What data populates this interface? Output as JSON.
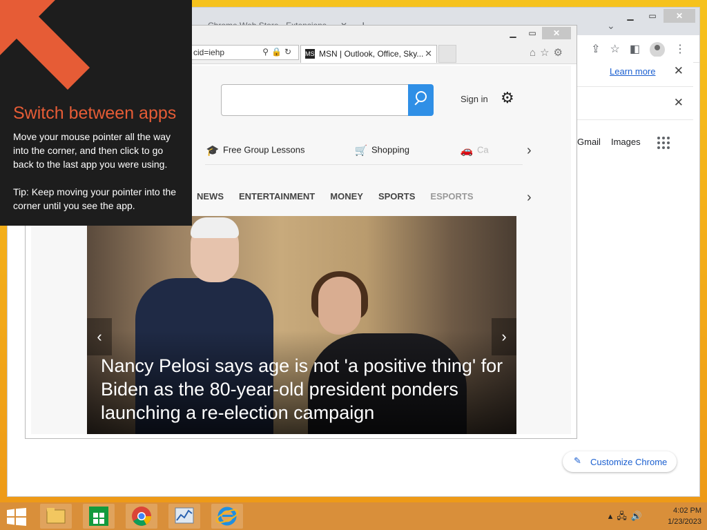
{
  "chrome": {
    "tab_label": "Chrome Web Store - Extensions",
    "learn_more": "Learn more",
    "links": [
      "Gmail",
      "Images"
    ],
    "customize_label": "Customize Chrome"
  },
  "ie": {
    "address_text": "cid=iehp",
    "tab_label": "MSN | Outlook, Office, Sky...",
    "favicon": "MSN",
    "page": {
      "sign_in": "Sign in",
      "quick_links": [
        {
          "label": "Free Group Lessons",
          "icon": "graduation-cap-icon"
        },
        {
          "label": "Shopping",
          "icon": "cart-icon"
        },
        {
          "label": "Ca",
          "icon": "car-icon"
        }
      ],
      "nav": [
        "NEWS",
        "ENTERTAINMENT",
        "MONEY",
        "SPORTS",
        "ESPORTS"
      ],
      "headline": "Nancy Pelosi says age is not 'a positive thing' for Biden as the 80-year-old president ponders launching a re-election campaign"
    }
  },
  "overlay": {
    "title": "Switch between apps",
    "body": "Move your mouse pointer all the way into the corner, and then click to go back to the last app you were using.",
    "tip": "Tip: Keep moving your pointer into the corner until you see the app.",
    "accent": "#e65c36"
  },
  "taskbar": {
    "time": "4:02 PM",
    "date": "1/23/2023"
  }
}
